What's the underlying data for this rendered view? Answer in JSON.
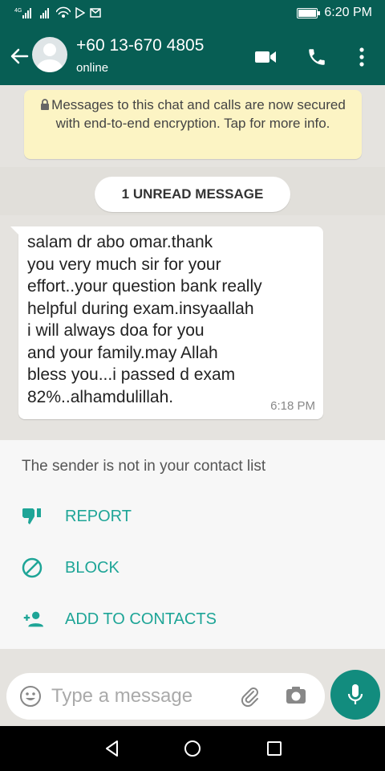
{
  "status_bar": {
    "signal_left": "4G",
    "time": "6:20 PM"
  },
  "header": {
    "contact_name": "+60 13-670 4805",
    "contact_status": "online"
  },
  "encryption_notice": {
    "text": "Messages to this chat and calls are now secured with end-to-end encryption. Tap for more info."
  },
  "unread_label": "1 UNREAD MESSAGE",
  "message": {
    "text": "salam dr abo omar.thank\nyou very much sir for your\neffort..your question bank really\nhelpful during exam.insyaallah\ni will always doa for you\nand your family.may Allah\nbless you...i passed d exam\n82%..alhamdulillah.",
    "time": "6:18 PM"
  },
  "unknown_contact": {
    "note": "The sender is not in your contact list",
    "actions": [
      {
        "label": "REPORT",
        "icon": "thumbs-down-icon"
      },
      {
        "label": "BLOCK",
        "icon": "block-icon"
      },
      {
        "label": "ADD TO CONTACTS",
        "icon": "add-contact-icon"
      }
    ]
  },
  "composer": {
    "placeholder": "Type a message"
  },
  "colors": {
    "header": "#075e54",
    "accent": "#1ea597",
    "mic_button": "#128c7e",
    "encryption_bg": "#fcf4c4",
    "chat_bg": "#e5e3df"
  }
}
